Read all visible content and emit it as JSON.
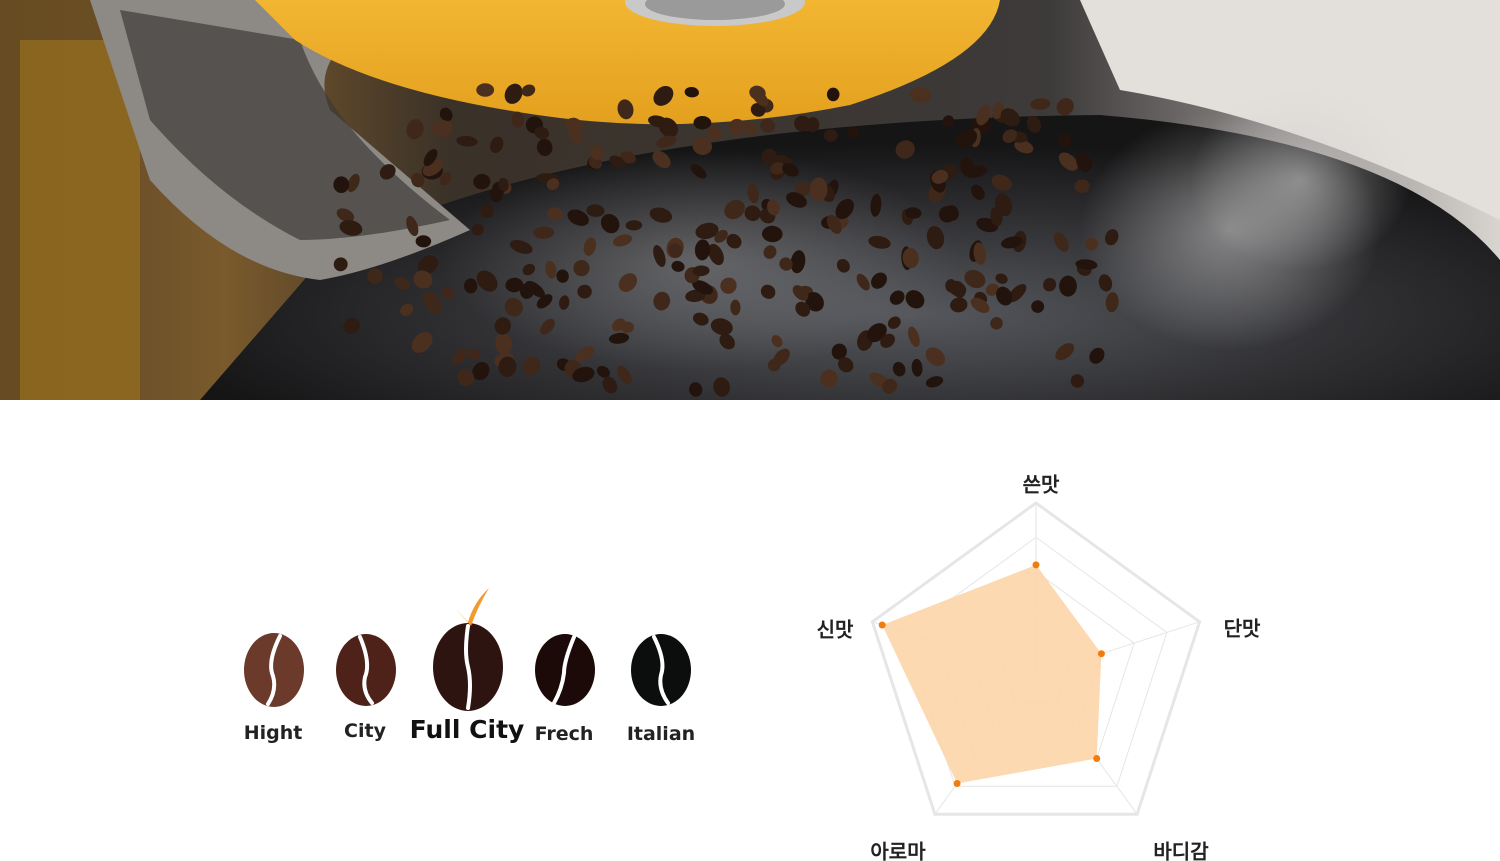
{
  "hero": {
    "image": "coffee-roaster-beans-photo"
  },
  "roast_levels": {
    "items": [
      {
        "label": "Hight",
        "color": "#6b3a2a"
      },
      {
        "label": "City",
        "color": "#4e2218"
      },
      {
        "label": "Full City",
        "color": "#2e1410"
      },
      {
        "label": "Frech",
        "color": "#1c0a08"
      },
      {
        "label": "Italian",
        "color": "#0c0e0e"
      }
    ],
    "selected_index": 2,
    "check_color": "#f39a2c"
  },
  "flavor_radar": {
    "axes": [
      "쓴맛",
      "단맛",
      "바디감",
      "아로마",
      "신맛"
    ],
    "max": 5,
    "levels": 5,
    "values": [
      3.2,
      2.0,
      3.0,
      3.9,
      4.7
    ],
    "fill_color": "#fdd5aa",
    "point_color": "#ef7d10",
    "grid_color": "#e6e6e6"
  }
}
